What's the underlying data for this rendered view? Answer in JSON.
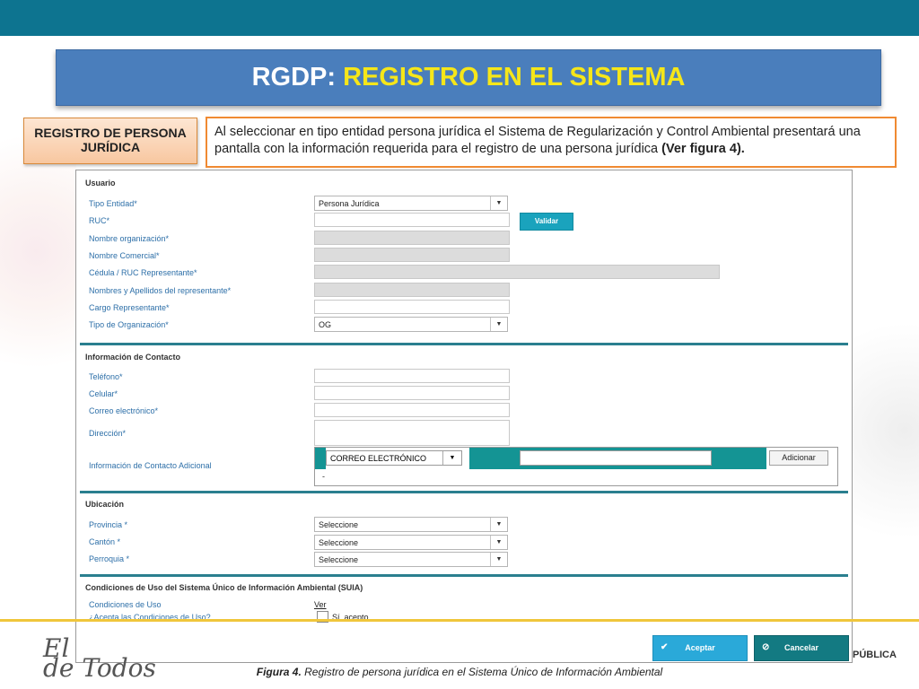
{
  "slide": {
    "title_prefix": "RGDP:",
    "title_highlight": "REGISTRO EN EL SISTEMA",
    "left_box_line1": "REGISTRO DE PERSONA",
    "left_box_line2": "JURÍDICA",
    "description": "Al seleccionar en tipo entidad persona jurídica el Sistema de Regularización y Control Ambiental presentará una pantalla con la información requerida para el registro de una persona jurídica",
    "description_bold": "(Ver figura 4).",
    "caption_bold": "Figura 4.",
    "caption_text": "Registro de persona jurídica en el Sistema Único de Información Ambiental",
    "logo_left_line1": "El",
    "logo_left_line2": "de Todos",
    "logo_right": "PÚBLICA",
    "colors": {
      "topbar": "#0d7490",
      "title_band": "#4a7ebc",
      "highlight": "#f6e619",
      "accent_orange": "#f08a32",
      "teal": "#149494"
    }
  },
  "form": {
    "usuario": {
      "title": "Usuario",
      "tipo_entidad_label": "Tipo Entidad*",
      "tipo_entidad_value": "Persona Jurídica",
      "ruc_label": "RUC*",
      "validar_button": "Validar",
      "nombre_organizacion_label": "Nombre organización*",
      "nombre_comercial_label": "Nombre Comercial*",
      "cedula_ruc_label": "Cédula / RUC Representante*",
      "nombres_label": "Nombres y Apellidos del representante*",
      "cargo_label": "Cargo Representante*",
      "tipo_org_label": "Tipo de Organización*",
      "tipo_org_value": "OG"
    },
    "contacto": {
      "title": "Información de Contacto",
      "telefono_label": "Teléfono*",
      "celular_label": "Celular*",
      "correo_label": "Correo electrónico*",
      "direccion_label": "Dirección*",
      "adicional_label": "Información de Contacto Adicional",
      "adicional_select": "CORREO ELECTRÓNICO",
      "adicional_button": "Adicionar",
      "adicional_row": "-"
    },
    "ubicacion": {
      "title": "Ubicación",
      "provincia_label": "Provincia *",
      "provincia_value": "Seleccione",
      "canton_label": "Cantón *",
      "canton_value": "Seleccione",
      "parroquia_label": "Perroquia *",
      "parroquia_value": "Seleccione"
    },
    "condiciones": {
      "title": "Condiciones de Uso del Sistema Único de Información Ambiental (SUIA)",
      "condiciones_label": "Condiciones de Uso",
      "ver_link": "Ver",
      "acepta_label": "¿Acepta las Condiciones de Uso?",
      "checkbox_label": "Sí, acepto."
    },
    "buttons": {
      "aceptar": "Aceptar",
      "cancelar": "Cancelar",
      "aceptar_icon": "check-icon",
      "cancelar_icon": "cancel-icon"
    }
  }
}
